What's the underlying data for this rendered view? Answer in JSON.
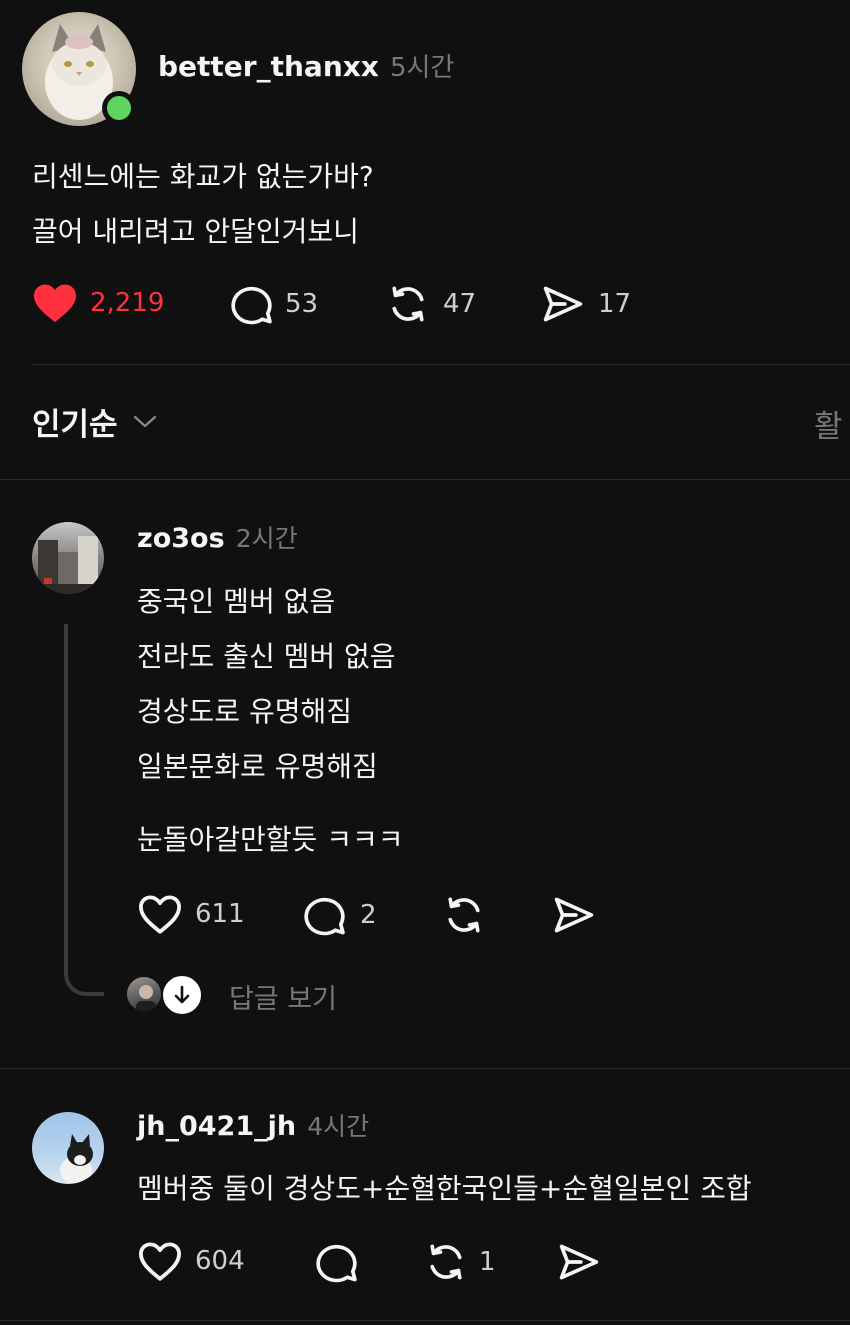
{
  "post": {
    "username": "better_thanxx",
    "time": "5시간",
    "lines": [
      "리센느에는 화교가 없는가바?",
      "끌어 내리려고 안달인거보니"
    ],
    "likes": "2,219",
    "comments": "53",
    "reposts": "47",
    "shares": "17",
    "accent": "#ff3040",
    "online_color": "#5ed35e"
  },
  "sort": {
    "label": "인기순",
    "right_label": "활"
  },
  "replies": [
    {
      "username": "zo3os",
      "time": "2시간",
      "lines": [
        "중국인 멤버 없음",
        "전라도 출신 멤버 없음",
        "경상도로 유명해짐",
        "일본문화로 유명해짐"
      ],
      "extra_line": "눈돌아갈만할듯 ㅋㅋㅋ",
      "likes": "611",
      "comments": "2",
      "view_replies": "답글 보기"
    },
    {
      "username": "jh_0421_jh",
      "time": "4시간",
      "lines": [
        "멤버중 둘이 경상도+순혈한국인들+순혈일본인 조합"
      ],
      "likes": "604",
      "reposts": "1"
    }
  ]
}
